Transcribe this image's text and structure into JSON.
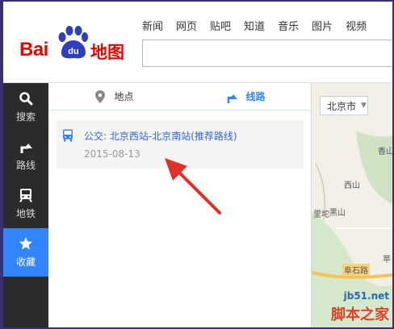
{
  "brand": {
    "logo_bai": "Bai",
    "logo_du": "du",
    "logo_ditu": "地图"
  },
  "nav": [
    "新闻",
    "网页",
    "贴吧",
    "知道",
    "音乐",
    "图片",
    "视频"
  ],
  "sidebar": {
    "items": [
      {
        "label": "搜索",
        "icon": "search-icon"
      },
      {
        "label": "路线",
        "icon": "route-icon"
      },
      {
        "label": "地铁",
        "icon": "subway-icon"
      },
      {
        "label": "收藏",
        "icon": "star-icon",
        "active": true
      }
    ]
  },
  "panel": {
    "tabs": [
      {
        "label": "地点",
        "icon": "location-pin-icon"
      },
      {
        "label": "线路",
        "icon": "route-icon",
        "active": true
      }
    ],
    "favorite": {
      "title": "公交: 北京西站-北京南站(推荐路线)",
      "date": "2015-08-13"
    }
  },
  "map": {
    "city_selector": "北京市",
    "labels": [
      "香山",
      "西山",
      "黑山",
      "里坨",
      "阜石路",
      "苹"
    ]
  },
  "watermark": {
    "url": "jb51.net",
    "name": "脚本之家"
  },
  "colors": {
    "accent": "#3385ff",
    "brand_red": "#e10602",
    "sidebar_bg": "#2b2b2b",
    "annotation": "#e0302a"
  }
}
